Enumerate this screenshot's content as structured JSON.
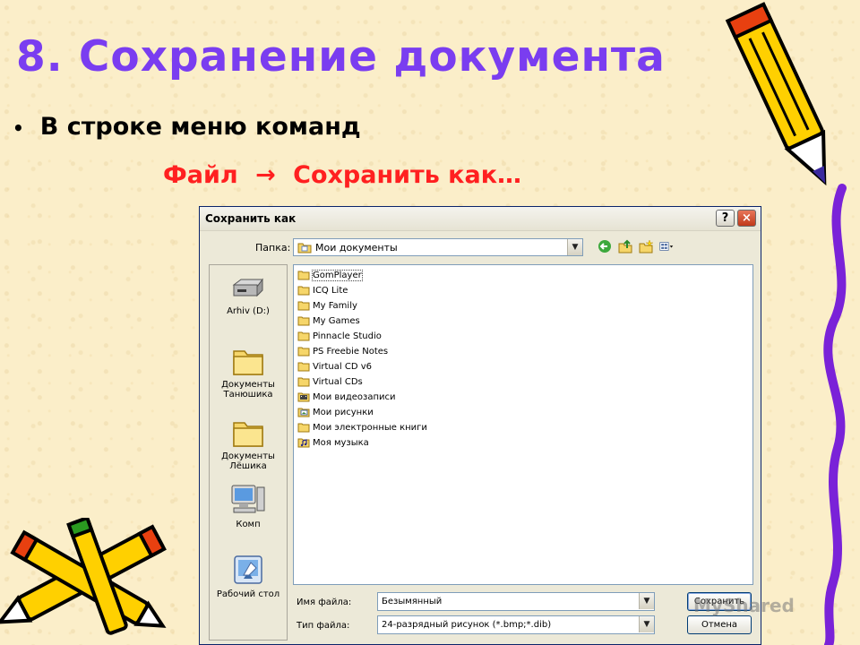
{
  "slide": {
    "title": "8. Сохранение документа",
    "bullet_text": "В строке меню команд",
    "menu_path": {
      "file": "Файл",
      "arrow": "→",
      "save_as": "Сохранить как…"
    }
  },
  "colors": {
    "title": "#7a3df0",
    "menu_path": "#ff2020",
    "background": "#fbeec9"
  },
  "dialog": {
    "title": "Сохранить как",
    "help_glyph": "?",
    "close_glyph": "×",
    "folder_label": "Папка:",
    "folder_value": "Мои документы",
    "places": [
      {
        "label": "Arhiv (D:)",
        "icon": "drive-icon"
      },
      {
        "label": "Документы Танюшика",
        "icon": "folder-icon"
      },
      {
        "label": "Документы Лёшика",
        "icon": "folder-icon"
      },
      {
        "label": "Комп",
        "icon": "computer-icon"
      },
      {
        "label": "Рабочий стол",
        "icon": "desktop-icon"
      }
    ],
    "files": [
      {
        "name": "GomPlayer",
        "icon": "folder-icon"
      },
      {
        "name": "ICQ Lite",
        "icon": "folder-icon"
      },
      {
        "name": "My Family",
        "icon": "folder-icon"
      },
      {
        "name": "My Games",
        "icon": "folder-icon"
      },
      {
        "name": "Pinnacle Studio",
        "icon": "folder-icon"
      },
      {
        "name": "PS Freebie Notes",
        "icon": "folder-icon"
      },
      {
        "name": "Virtual CD v6",
        "icon": "folder-icon"
      },
      {
        "name": "Virtual CDs",
        "icon": "folder-icon"
      },
      {
        "name": "Мои видеозаписи",
        "icon": "video-folder-icon"
      },
      {
        "name": "Мои рисунки",
        "icon": "pictures-folder-icon"
      },
      {
        "name": "Мои электронные книги",
        "icon": "folder-icon"
      },
      {
        "name": "Моя музыка",
        "icon": "music-folder-icon"
      }
    ],
    "filename_label": "Имя файла:",
    "filename_value": "Безымянный",
    "filetype_label": "Тип файла:",
    "filetype_value": "24-разрядный рисунок (*.bmp;*.dib)",
    "save_button": "Сохранить",
    "cancel_button": "Отмена"
  },
  "watermark": "MyShared"
}
